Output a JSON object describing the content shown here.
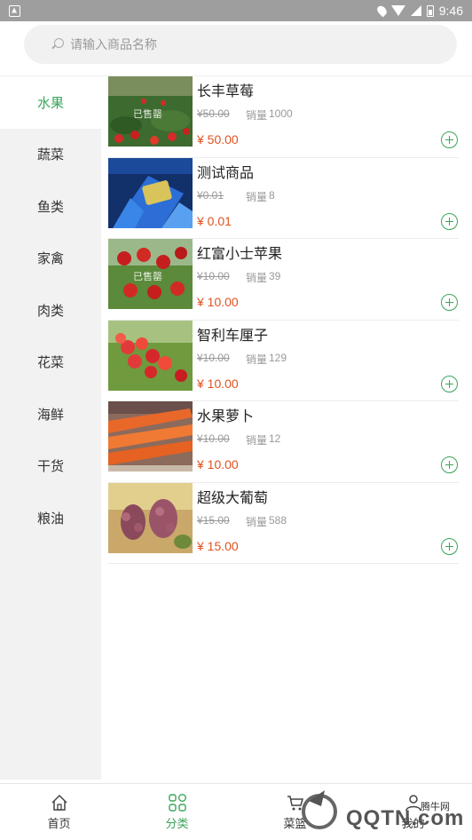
{
  "status_bar": {
    "time": "9:46"
  },
  "search": {
    "placeholder": "请输入商品名称"
  },
  "categories": [
    {
      "label": "水果",
      "active": true
    },
    {
      "label": "蔬菜"
    },
    {
      "label": "鱼类"
    },
    {
      "label": "家禽"
    },
    {
      "label": "肉类"
    },
    {
      "label": "花菜"
    },
    {
      "label": "海鲜"
    },
    {
      "label": "干货"
    },
    {
      "label": "粮油"
    }
  ],
  "products": [
    {
      "name": "长丰草莓",
      "old_price": "¥50.00",
      "sales_label": "销量",
      "sales": "1000",
      "price": "¥ 50.00",
      "stamp": "已售罄",
      "image": "strawberries"
    },
    {
      "name": "测试商品",
      "old_price": "¥0.01",
      "sales_label": "销量",
      "sales": "8",
      "price": "¥ 0.01",
      "image": "phone-hand"
    },
    {
      "name": "红富小士苹果",
      "old_price": "¥10.00",
      "sales_label": "销量",
      "sales": "39",
      "price": "¥ 10.00",
      "stamp": "已售罄",
      "image": "apples"
    },
    {
      "name": "智利车厘子",
      "old_price": "¥10.00",
      "sales_label": "销量",
      "sales": "129",
      "price": "¥ 10.00",
      "image": "cherries"
    },
    {
      "name": "水果萝卜",
      "old_price": "¥10.00",
      "sales_label": "销量",
      "sales": "12",
      "price": "¥ 10.00",
      "image": "carrots"
    },
    {
      "name": "超级大葡萄",
      "old_price": "¥15.00",
      "sales_label": "销量",
      "sales": "588",
      "price": "¥ 15.00",
      "image": "grapes"
    }
  ],
  "bottom_nav": [
    {
      "label": "首页",
      "icon": "home-icon"
    },
    {
      "label": "分类",
      "icon": "category-icon",
      "active": true
    },
    {
      "label": "菜篮",
      "icon": "cart-icon"
    },
    {
      "label": "我的",
      "icon": "user-icon"
    }
  ],
  "watermark": {
    "small": "腾牛网",
    "big": "QQTN.com"
  },
  "colors": {
    "accent": "#3aa55a",
    "price": "#e0521f",
    "sidebar_bg": "#f2f2f2"
  }
}
